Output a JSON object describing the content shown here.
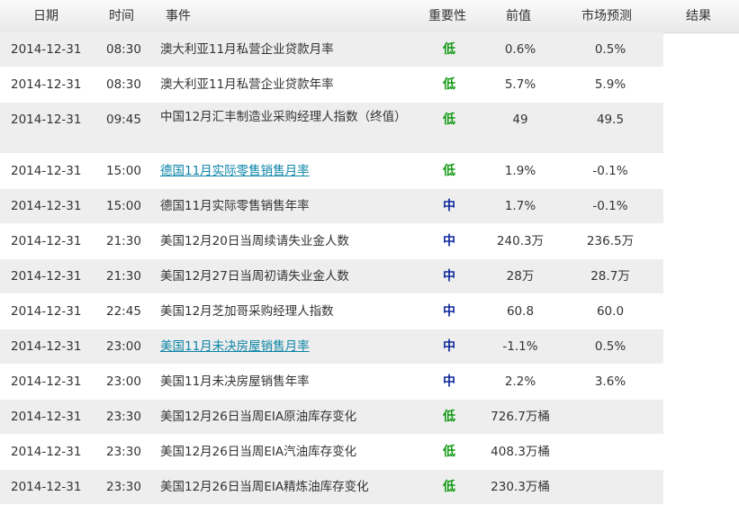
{
  "headers": {
    "date": "日期",
    "time": "时间",
    "event": "事件",
    "importance": "重要性",
    "previous": "前值",
    "forecast": "市场预测",
    "result": "结果"
  },
  "rows": [
    {
      "date": "2014-12-31",
      "time": "08:30",
      "event": "澳大利亚11月私营企业贷款月率",
      "importance": "低",
      "previous": "0.6%",
      "forecast": "0.5%",
      "result": ""
    },
    {
      "date": "2014-12-31",
      "time": "08:30",
      "event": "澳大利亚11月私营企业贷款年率",
      "importance": "低",
      "previous": "5.7%",
      "forecast": "5.9%",
      "result": ""
    },
    {
      "date": "2014-12-31",
      "time": "09:45",
      "event": "中国12月汇丰制造业采购经理人指数（终值）",
      "importance": "低",
      "previous": "49",
      "forecast": "49.5",
      "result": ""
    },
    {
      "date": "2014-12-31",
      "time": "15:00",
      "event": "德国11月实际零售销售月率",
      "importance": "低",
      "previous": "1.9%",
      "forecast": "-0.1%",
      "result": ""
    },
    {
      "date": "2014-12-31",
      "time": "15:00",
      "event": "德国11月实际零售销售年率",
      "importance": "中",
      "previous": "1.7%",
      "forecast": "-0.1%",
      "result": ""
    },
    {
      "date": "2014-12-31",
      "time": "21:30",
      "event": "美国12月20日当周续请失业金人数",
      "importance": "中",
      "previous": "240.3万",
      "forecast": "236.5万",
      "result": ""
    },
    {
      "date": "2014-12-31",
      "time": "21:30",
      "event": "美国12月27日当周初请失业金人数",
      "importance": "中",
      "previous": "28万",
      "forecast": "28.7万",
      "result": ""
    },
    {
      "date": "2014-12-31",
      "time": "22:45",
      "event": "美国12月芝加哥采购经理人指数",
      "importance": "中",
      "previous": "60.8",
      "forecast": "60.0",
      "result": ""
    },
    {
      "date": "2014-12-31",
      "time": "23:00",
      "event": "美国11月未决房屋销售月率",
      "importance": "中",
      "previous": "-1.1%",
      "forecast": "0.5%",
      "result": ""
    },
    {
      "date": "2014-12-31",
      "time": "23:00",
      "event": "美国11月未决房屋销售年率",
      "importance": "中",
      "previous": "2.2%",
      "forecast": "3.6%",
      "result": ""
    },
    {
      "date": "2014-12-31",
      "time": "23:30",
      "event": "美国12月26日当周EIA原油库存变化",
      "importance": "低",
      "previous": "726.7万桶",
      "forecast": "",
      "result": ""
    },
    {
      "date": "2014-12-31",
      "time": "23:30",
      "event": "美国12月26日当周EIA汽油库存变化",
      "importance": "低",
      "previous": "408.3万桶",
      "forecast": "",
      "result": ""
    },
    {
      "date": "2014-12-31",
      "time": "23:30",
      "event": "美国12月26日当周EIA精炼油库存变化",
      "importance": "低",
      "previous": "230.3万桶",
      "forecast": "",
      "result": ""
    }
  ],
  "colors": {
    "low": "#119911",
    "mid": "#102a9c",
    "link": "#0d85a8",
    "row_alt": "#eeeeee"
  }
}
